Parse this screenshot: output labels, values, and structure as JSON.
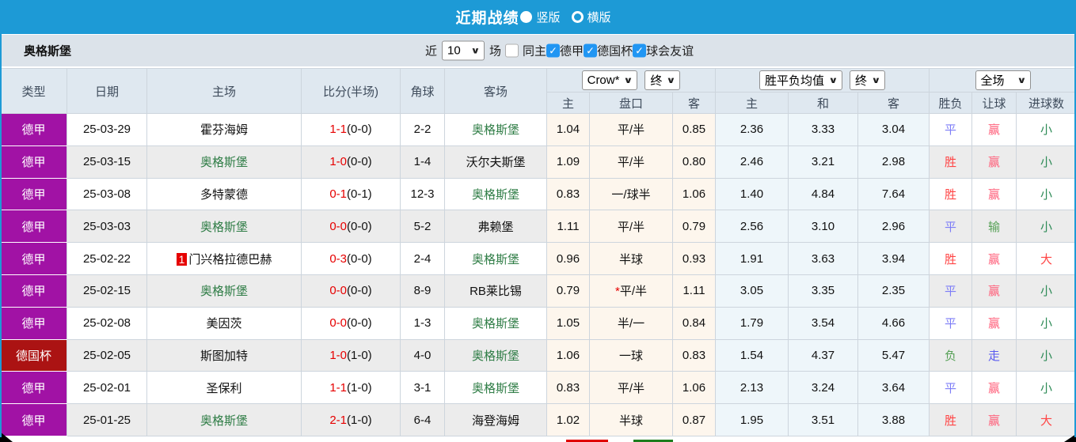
{
  "topbar": {
    "title": "近期战绩",
    "options": [
      {
        "label": "竖版",
        "selected": true
      },
      {
        "label": "横版",
        "selected": false
      }
    ]
  },
  "filter": {
    "team": "奥格斯堡",
    "recent_label": "近",
    "recent_value": "10",
    "unit_label": "场",
    "same_home_label": "同主",
    "same_home_checked": false,
    "leagues": [
      {
        "label": "德甲",
        "checked": true
      },
      {
        "label": "德国杯",
        "checked": true
      },
      {
        "label": "球会友谊",
        "checked": true
      }
    ],
    "check_glyph": "✓"
  },
  "table": {
    "main_headers": [
      "类型",
      "日期",
      "主场",
      "比分(半场)",
      "角球",
      "客场"
    ],
    "selects": {
      "odds_company": "Crow*",
      "odds_time": "终",
      "avg_label": "胜平负均值",
      "avg_time": "终",
      "scope": "全场"
    },
    "sub_headers": [
      "主",
      "盘口",
      "客",
      "主",
      "和",
      "客",
      "胜负",
      "让球",
      "进球数"
    ],
    "rows": [
      {
        "league": "德甲",
        "date": "25-03-29",
        "home": "霍芬海姆",
        "home_focus": false,
        "home_badge": null,
        "score_ft": "1-1",
        "score_ht": "(0-0)",
        "corners": "2-2",
        "away": "奥格斯堡",
        "away_focus": true,
        "odds_home": "1.04",
        "handicap": "平/半",
        "handicap_star": false,
        "odds_away": "0.85",
        "avg_home": "2.36",
        "avg_draw": "3.33",
        "avg_away": "3.04",
        "result": "平",
        "handicap_result": "赢",
        "goals": "小"
      },
      {
        "league": "德甲",
        "date": "25-03-15",
        "home": "奥格斯堡",
        "home_focus": true,
        "home_badge": null,
        "score_ft": "1-0",
        "score_ht": "(0-0)",
        "corners": "1-4",
        "away": "沃尔夫斯堡",
        "away_focus": false,
        "odds_home": "1.09",
        "handicap": "平/半",
        "handicap_star": false,
        "odds_away": "0.80",
        "avg_home": "2.46",
        "avg_draw": "3.21",
        "avg_away": "2.98",
        "result": "胜",
        "handicap_result": "赢",
        "goals": "小"
      },
      {
        "league": "德甲",
        "date": "25-03-08",
        "home": "多特蒙德",
        "home_focus": false,
        "home_badge": null,
        "score_ft": "0-1",
        "score_ht": "(0-1)",
        "corners": "12-3",
        "away": "奥格斯堡",
        "away_focus": true,
        "odds_home": "0.83",
        "handicap": "一/球半",
        "handicap_star": false,
        "odds_away": "1.06",
        "avg_home": "1.40",
        "avg_draw": "4.84",
        "avg_away": "7.64",
        "result": "胜",
        "handicap_result": "赢",
        "goals": "小"
      },
      {
        "league": "德甲",
        "date": "25-03-03",
        "home": "奥格斯堡",
        "home_focus": true,
        "home_badge": null,
        "score_ft": "0-0",
        "score_ht": "(0-0)",
        "corners": "5-2",
        "away": "弗赖堡",
        "away_focus": false,
        "odds_home": "1.11",
        "handicap": "平/半",
        "handicap_star": false,
        "odds_away": "0.79",
        "avg_home": "2.56",
        "avg_draw": "3.10",
        "avg_away": "2.96",
        "result": "平",
        "handicap_result": "输",
        "goals": "小"
      },
      {
        "league": "德甲",
        "date": "25-02-22",
        "home": "门兴格拉德巴赫",
        "home_focus": false,
        "home_badge": "1",
        "score_ft": "0-3",
        "score_ht": "(0-0)",
        "corners": "2-4",
        "away": "奥格斯堡",
        "away_focus": true,
        "odds_home": "0.96",
        "handicap": "半球",
        "handicap_star": false,
        "odds_away": "0.93",
        "avg_home": "1.91",
        "avg_draw": "3.63",
        "avg_away": "3.94",
        "result": "胜",
        "handicap_result": "赢",
        "goals": "大"
      },
      {
        "league": "德甲",
        "date": "25-02-15",
        "home": "奥格斯堡",
        "home_focus": true,
        "home_badge": null,
        "score_ft": "0-0",
        "score_ht": "(0-0)",
        "corners": "8-9",
        "away": "RB莱比锡",
        "away_focus": false,
        "odds_home": "0.79",
        "handicap": "平/半",
        "handicap_star": true,
        "odds_away": "1.11",
        "avg_home": "3.05",
        "avg_draw": "3.35",
        "avg_away": "2.35",
        "result": "平",
        "handicap_result": "赢",
        "goals": "小"
      },
      {
        "league": "德甲",
        "date": "25-02-08",
        "home": "美因茨",
        "home_focus": false,
        "home_badge": null,
        "score_ft": "0-0",
        "score_ht": "(0-0)",
        "corners": "1-3",
        "away": "奥格斯堡",
        "away_focus": true,
        "odds_home": "1.05",
        "handicap": "半/一",
        "handicap_star": false,
        "odds_away": "0.84",
        "avg_home": "1.79",
        "avg_draw": "3.54",
        "avg_away": "4.66",
        "result": "平",
        "handicap_result": "赢",
        "goals": "小"
      },
      {
        "league": "德国杯",
        "date": "25-02-05",
        "home": "斯图加特",
        "home_focus": false,
        "home_badge": null,
        "score_ft": "1-0",
        "score_ht": "(1-0)",
        "corners": "4-0",
        "away": "奥格斯堡",
        "away_focus": true,
        "odds_home": "1.06",
        "handicap": "一球",
        "handicap_star": false,
        "odds_away": "0.83",
        "avg_home": "1.54",
        "avg_draw": "4.37",
        "avg_away": "5.47",
        "result": "负",
        "handicap_result": "走",
        "goals": "小"
      },
      {
        "league": "德甲",
        "date": "25-02-01",
        "home": "圣保利",
        "home_focus": false,
        "home_badge": null,
        "score_ft": "1-1",
        "score_ht": "(1-0)",
        "corners": "3-1",
        "away": "奥格斯堡",
        "away_focus": true,
        "odds_home": "0.83",
        "handicap": "平/半",
        "handicap_star": false,
        "odds_away": "1.06",
        "avg_home": "2.13",
        "avg_draw": "3.24",
        "avg_away": "3.64",
        "result": "平",
        "handicap_result": "赢",
        "goals": "小"
      },
      {
        "league": "德甲",
        "date": "25-01-25",
        "home": "奥格斯堡",
        "home_focus": true,
        "home_badge": null,
        "score_ft": "2-1",
        "score_ht": "(1-0)",
        "corners": "6-4",
        "away": "海登海姆",
        "away_focus": false,
        "odds_home": "1.02",
        "handicap": "半球",
        "handicap_star": false,
        "odds_away": "0.87",
        "avg_home": "1.95",
        "avg_draw": "3.51",
        "avg_away": "3.88",
        "result": "胜",
        "handicap_result": "赢",
        "goals": "大"
      }
    ]
  },
  "colors": {
    "topbar_bg": "#1d9ad6",
    "league": {
      "德甲": "#a112a5",
      "德国杯": "#ab1313"
    },
    "focus_team": "#2f7d46",
    "score_ft": "#e60000",
    "values": {
      "胜": "#ff4545",
      "平": "#7d7df7",
      "负": "#55a055",
      "赢": "#ff5f7a",
      "输": "#55a055",
      "走": "#5a5af0",
      "大": "#ff4545",
      "小": "#2e8b57"
    },
    "legend_swatches": [
      "#e00000",
      "#1e7d1e"
    ]
  }
}
